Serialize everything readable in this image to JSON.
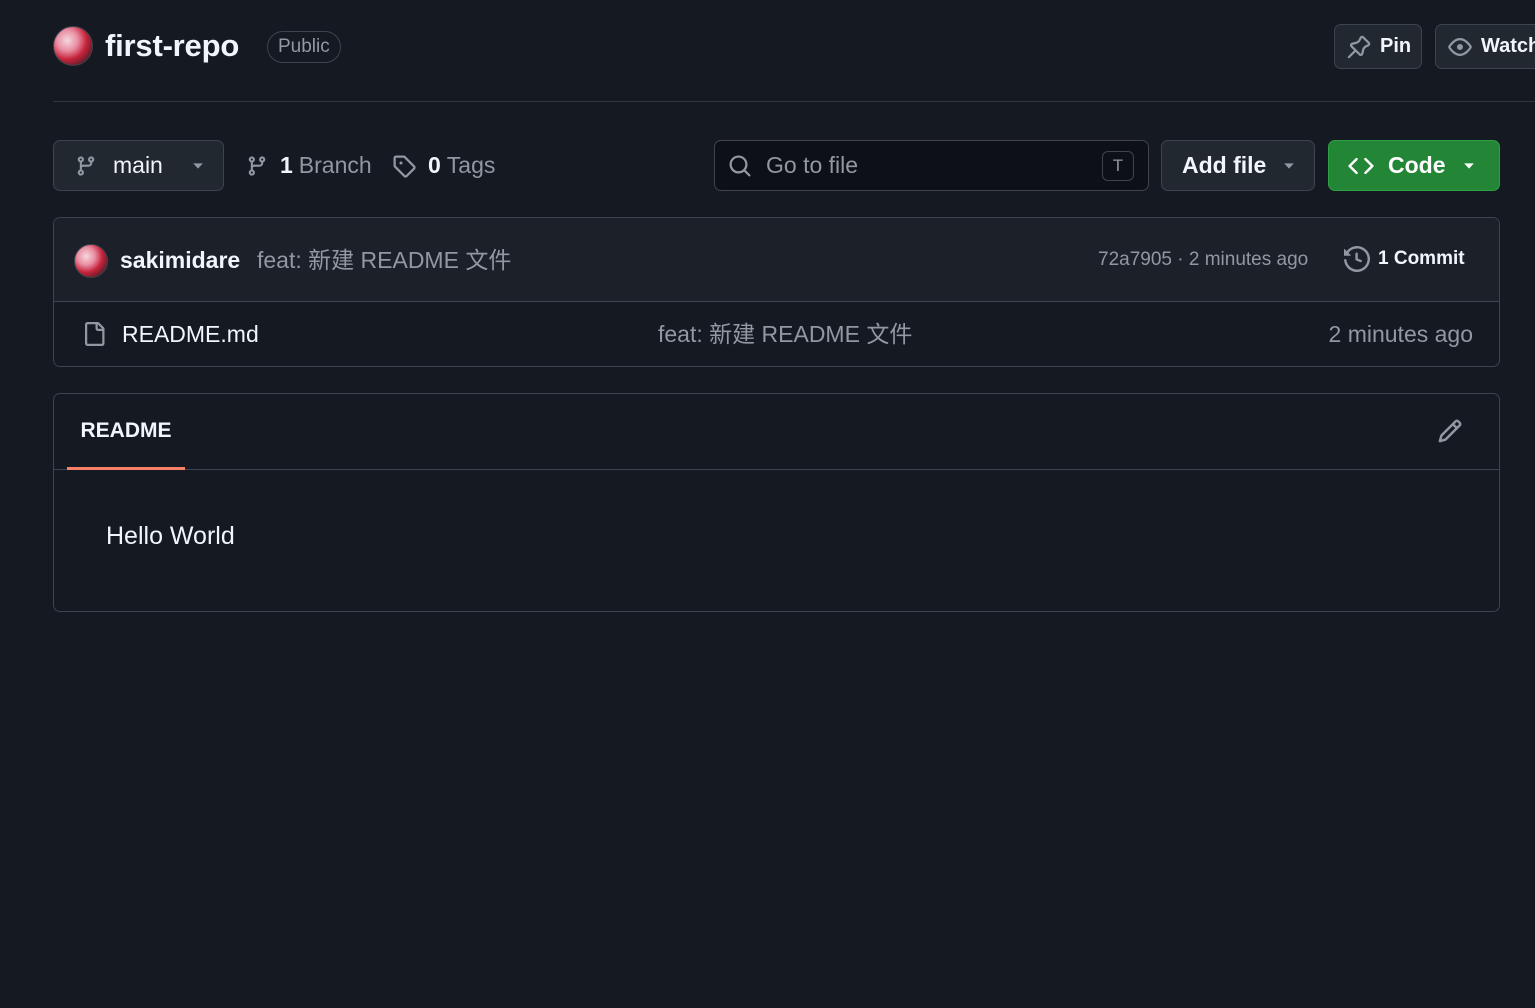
{
  "repo": {
    "name": "first-repo",
    "visibility": "Public"
  },
  "header_actions": {
    "pin_label": "Pin",
    "watch_label": "Watch"
  },
  "toolbar": {
    "branch": "main",
    "branch_count": "1",
    "branch_label": "Branch",
    "tag_count": "0",
    "tag_label": "Tags",
    "search_placeholder": "Go to file",
    "search_shortcut": "T",
    "add_file_label": "Add file",
    "code_label": "Code"
  },
  "latest_commit": {
    "author": "sakimidare",
    "message": "feat: 新建 README 文件",
    "sha": "72a7905",
    "separator": " · ",
    "time": "2 minutes ago",
    "commits_label": "1 Commit"
  },
  "files": [
    {
      "name": "README.md",
      "commit_message": "feat: 新建 README 文件",
      "time": "2 minutes ago"
    }
  ],
  "readme": {
    "tab_label": "README",
    "content": "Hello World"
  },
  "colors": {
    "background": "#151921",
    "border": "#3d444d",
    "code_button": "#238636",
    "tab_underline": "#f78166"
  },
  "icons": {
    "pin": "pin-icon",
    "watch": "eye-icon",
    "branch": "git-branch-icon",
    "tag": "tag-icon",
    "search": "search-icon",
    "code": "code-icon",
    "history": "history-icon",
    "file": "file-icon",
    "edit": "pencil-icon"
  }
}
